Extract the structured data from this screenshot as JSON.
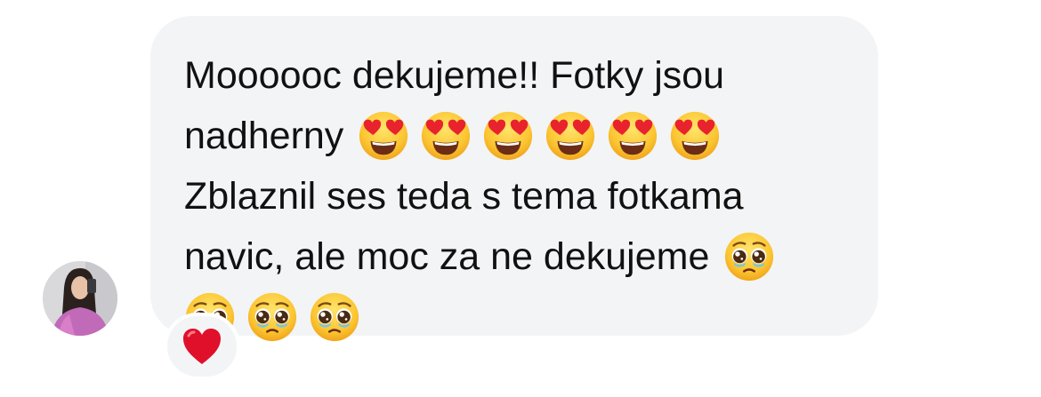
{
  "message": {
    "lines": [
      {
        "text": "Moooooc dekujeme!! Fotky jsou",
        "emojis": []
      },
      {
        "text": "nadherny",
        "emojis": [
          "heart-eyes",
          "heart-eyes",
          "heart-eyes",
          "heart-eyes",
          "heart-eyes",
          "heart-eyes"
        ]
      },
      {
        "text": "Zblaznil ses teda s tema fotkama",
        "emojis": []
      },
      {
        "text": "navic, ale moc za ne dekujeme",
        "emojis": [
          "pleading-face"
        ]
      },
      {
        "text": "",
        "emojis": [
          "pleading-face",
          "pleading-face",
          "pleading-face"
        ]
      }
    ],
    "bubble_color": "#f3f4f6",
    "text_color": "#111111"
  },
  "sender": {
    "avatar_icon": "avatar-photo"
  },
  "reaction": {
    "icon": "red-heart-icon",
    "color": "#e0102b"
  }
}
